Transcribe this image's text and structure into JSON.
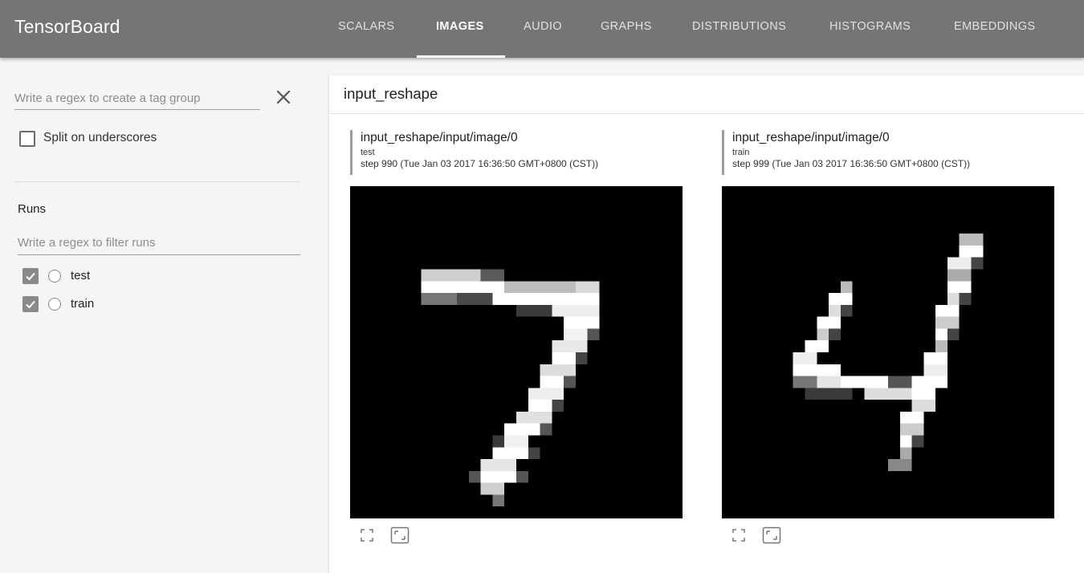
{
  "header": {
    "app_title": "TensorBoard",
    "tabs": [
      {
        "label": "SCALARS",
        "active": false
      },
      {
        "label": "IMAGES",
        "active": true
      },
      {
        "label": "AUDIO",
        "active": false
      },
      {
        "label": "GRAPHS",
        "active": false
      },
      {
        "label": "DISTRIBUTIONS",
        "active": false
      },
      {
        "label": "HISTOGRAMS",
        "active": false
      },
      {
        "label": "EMBEDDINGS",
        "active": false
      }
    ],
    "bar_color": "#757575"
  },
  "sidebar": {
    "tag_group_placeholder": "Write a regex to create a tag group",
    "clear_icon": "close-icon",
    "split_label": "Split on underscores",
    "split_checked": false,
    "runs_title": "Runs",
    "runs_filter_placeholder": "Write a regex to filter runs",
    "runs": [
      {
        "label": "test",
        "checked": true
      },
      {
        "label": "train",
        "checked": true
      }
    ]
  },
  "main": {
    "group_title": "input_reshape",
    "images": [
      {
        "tag": "input_reshape/input/image/0",
        "run": "test",
        "step": "step 990 (Tue Jan 03 2017 16:36:50 GMT+0800 (CST))",
        "digit_icon": "mnist-digit-7"
      },
      {
        "tag": "input_reshape/input/image/0",
        "run": "train",
        "step": "step 999 (Tue Jan 03 2017 16:36:50 GMT+0800 (CST))",
        "digit_icon": "mnist-digit-4"
      }
    ],
    "controls": {
      "fullscreen_icon": "fullscreen-icon",
      "actual_size_icon": "actual-size-icon"
    }
  }
}
